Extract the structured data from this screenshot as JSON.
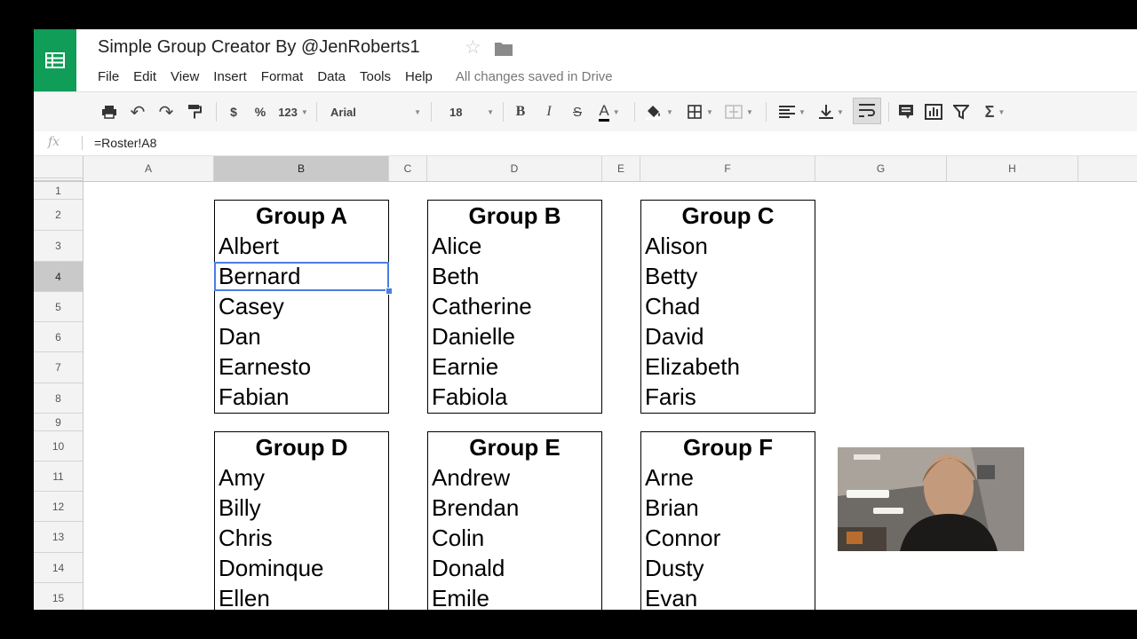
{
  "app": {
    "title": "Simple Group Creator By @JenRoberts1",
    "save_status": "All changes saved in Drive",
    "menu": [
      "File",
      "Edit",
      "View",
      "Insert",
      "Format",
      "Data",
      "Tools",
      "Help"
    ]
  },
  "toolbar": {
    "currency": "$",
    "percent": "%",
    "more_formats": "123",
    "font": "Arial",
    "font_size": "18",
    "bold": "B",
    "italic": "I",
    "strike": "S",
    "text_color": "A",
    "sum": "Σ"
  },
  "formula_bar": {
    "fx_label": "fx",
    "value": "=Roster!A8"
  },
  "columns": [
    "A",
    "B",
    "C",
    "D",
    "E",
    "F",
    "G",
    "H"
  ],
  "rows": [
    "1",
    "2",
    "3",
    "4",
    "5",
    "6",
    "7",
    "8",
    "9",
    "10",
    "11",
    "12",
    "13",
    "14",
    "15"
  ],
  "selected": {
    "column": "B",
    "row": "4"
  },
  "groups": [
    {
      "title": "Group A",
      "members": [
        "Albert",
        "Bernard",
        "Casey",
        "Dan",
        "Earnesto",
        "Fabian"
      ]
    },
    {
      "title": "Group B",
      "members": [
        "Alice",
        "Beth",
        "Catherine",
        "Danielle",
        "Earnie",
        "Fabiola"
      ]
    },
    {
      "title": "Group C",
      "members": [
        "Alison",
        "Betty",
        "Chad",
        "David",
        "Elizabeth",
        "Faris"
      ]
    },
    {
      "title": "Group D",
      "members": [
        "Amy",
        "Billy",
        "Chris",
        "Dominque",
        "Ellen"
      ]
    },
    {
      "title": "Group E",
      "members": [
        "Andrew",
        "Brendan",
        "Colin",
        "Donald",
        "Emile"
      ]
    },
    {
      "title": "Group F",
      "members": [
        "Arne",
        "Brian",
        "Connor",
        "Dusty",
        "Evan"
      ]
    }
  ],
  "colors": {
    "brand": "#0f9d58",
    "selection": "#4a7ee3"
  }
}
